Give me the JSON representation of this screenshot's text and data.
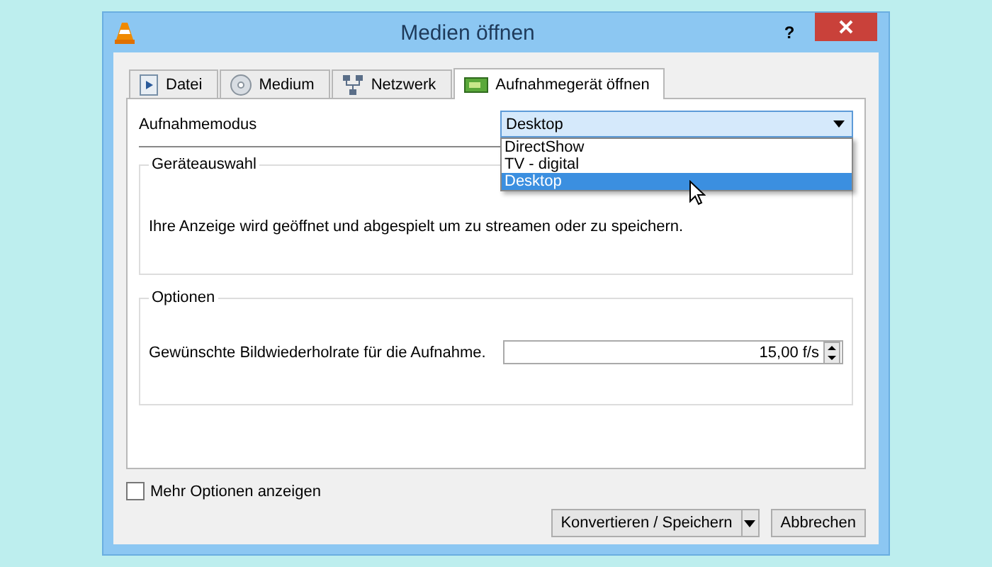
{
  "window": {
    "title": "Medien öffnen",
    "help": "?"
  },
  "tabs": [
    {
      "label": "Datei",
      "kind": "file",
      "selected": false
    },
    {
      "label": "Medium",
      "kind": "disc",
      "selected": false
    },
    {
      "label": "Netzwerk",
      "kind": "network",
      "selected": false
    },
    {
      "label": "Aufnahmegerät öffnen",
      "kind": "capture",
      "selected": true
    }
  ],
  "capture_mode": {
    "label": "Aufnahmemodus",
    "value": "Desktop",
    "open": true,
    "options": [
      {
        "label": "DirectShow",
        "selected": false
      },
      {
        "label": "TV - digital",
        "selected": false
      },
      {
        "label": "Desktop",
        "selected": true
      }
    ]
  },
  "device_group": {
    "title": "Geräteauswahl",
    "text": "Ihre Anzeige wird geöffnet und abgespielt um zu streamen oder zu speichern."
  },
  "options_group": {
    "title": "Optionen",
    "label": "Gewünschte Bildwiederholrate für die Aufnahme.",
    "value": "15,00 f/s"
  },
  "more_options": {
    "label": "Mehr Optionen anzeigen",
    "checked": false
  },
  "buttons": [
    {
      "label": "Konvertieren / Speichern",
      "kind": "split"
    },
    {
      "label": "Abbrechen",
      "kind": "plain"
    }
  ]
}
